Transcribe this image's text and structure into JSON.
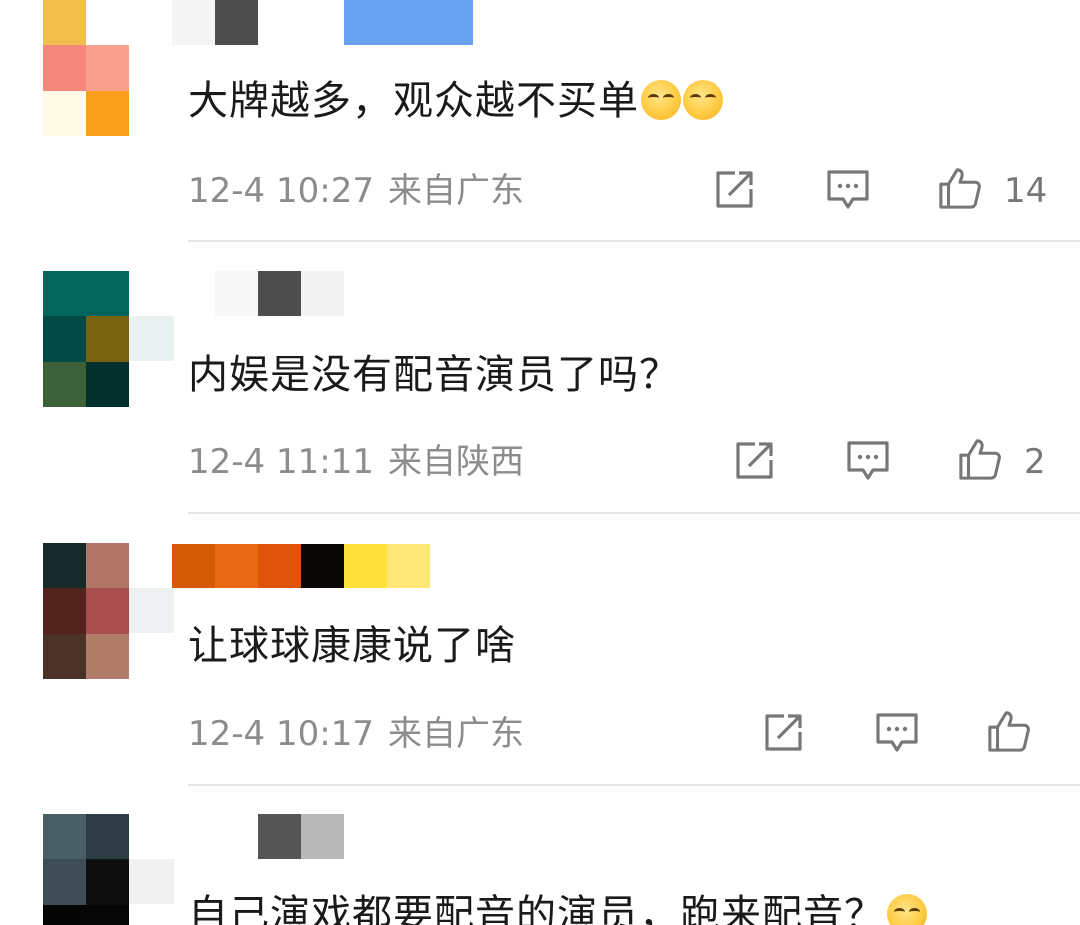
{
  "comments": [
    {
      "text": "大牌越多，观众越不买单",
      "emoji": [
        "thinking-face-emoji",
        "thinking-face-emoji"
      ],
      "time": "12-4 10:27",
      "location": "来自广东",
      "likes": "14"
    },
    {
      "text": "内娱是没有配音演员了吗？",
      "time": "12-4 11:11",
      "location": "来自陕西",
      "likes": "2"
    },
    {
      "text": "让球球康康说了啥",
      "time": "12-4 10:17",
      "location": "来自广东",
      "likes": ""
    },
    {
      "text": "自己演戏都要配音的演员，跑来配音？",
      "emoji": [
        "grinning-sweat-emoji"
      ]
    }
  ],
  "colors": {
    "text": "#1a1a1a",
    "meta": "#8c8c8c",
    "icon": "#777777",
    "divider": "#e6e6e6",
    "avatar_1": [
      "#f2c04a",
      "#ffffff",
      "#f5877c",
      "#f9a08f",
      "#fffbe6",
      "#f9a01b"
    ],
    "avatar_2": [
      "#02665d",
      "#02665d",
      "#024a44",
      "#7a6310",
      "#3c6038",
      "#03302c"
    ],
    "avatar_3": [
      "#162a2a",
      "#b07564",
      "#53241d",
      "#a94e4f",
      "#4a3226",
      "#b07d68"
    ],
    "avatar_4": [
      "#4a5e66",
      "#2c3b44",
      "#3e4d55",
      "#0e0e0e",
      "#050505",
      "#060606"
    ],
    "username_1": [
      "#f5f5f5",
      "#4d4d4d",
      "#ffffff",
      "#ffffff",
      "#6aa3f2",
      "#6aa3f2",
      "#6aa3f2"
    ],
    "username_2": [
      "#f7f7f7",
      "#4d4d4d",
      "#f2f2f2"
    ],
    "username_3": [
      "#d45a06",
      "#e96a14",
      "#df5209",
      "#0a0606",
      "#ffe03a",
      "#ffe676"
    ],
    "username_4": [
      "#ffffff",
      "#555555",
      "#b8b8b8"
    ]
  }
}
